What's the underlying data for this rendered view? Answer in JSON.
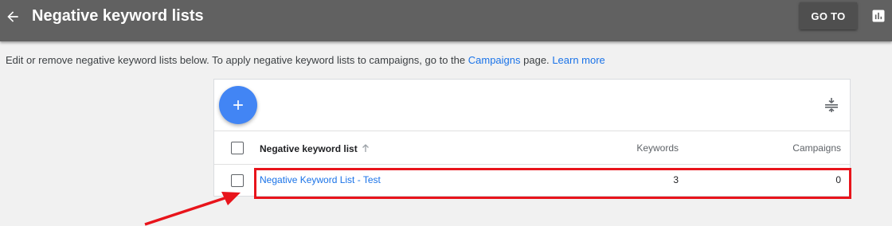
{
  "header": {
    "title": "Negative keyword lists",
    "goto_label": "GO TO"
  },
  "info": {
    "text_before": "Edit or remove negative keyword lists below. To apply negative keyword lists to campaigns, go to the",
    "campaigns_link": "Campaigns",
    "text_after": "page.",
    "learn_more": "Learn more"
  },
  "table": {
    "columns": {
      "name": "Negative keyword list",
      "keywords": "Keywords",
      "campaigns": "Campaigns"
    },
    "rows": [
      {
        "name": "Negative Keyword List - Test",
        "keywords": "3",
        "campaigns": "0"
      }
    ]
  },
  "colors": {
    "topbar": "#616161",
    "accent": "#4285f4",
    "link": "#1a73e8",
    "annotation": "#e8141b"
  }
}
